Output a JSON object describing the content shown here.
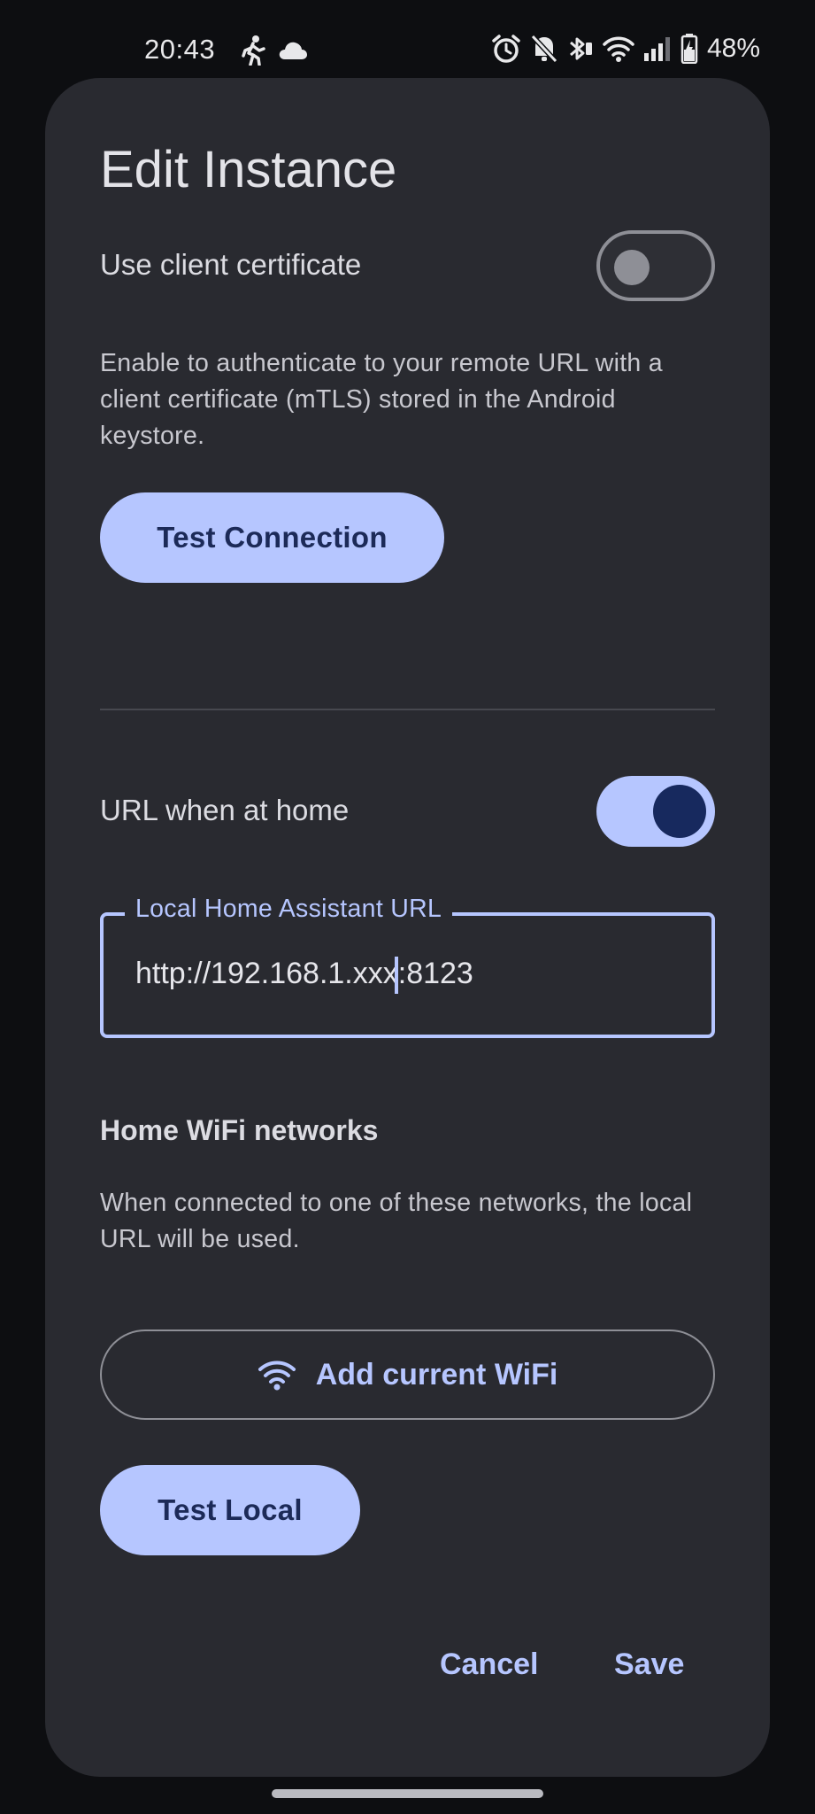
{
  "status_bar": {
    "time": "20:43",
    "battery": "48%",
    "icons": [
      "walking-icon",
      "cloud-icon",
      "alarm-icon",
      "notifications-off-icon",
      "bluetooth-icon",
      "wifi-icon",
      "signal-icon",
      "battery-charging-icon"
    ]
  },
  "dialog": {
    "title": "Edit Instance",
    "client_certificate": {
      "label": "Use client certificate",
      "enabled": false,
      "description": "Enable to authenticate to your remote URL with a client certificate (mTLS) stored in the Android keystore."
    },
    "test_connection_label": "Test Connection",
    "home_url": {
      "label": "URL when at home",
      "enabled": true
    },
    "local_url_field": {
      "label": "Local Home Assistant URL",
      "value": "http://192.168.1.xxx:8123"
    },
    "home_wifi": {
      "heading": "Home WiFi networks",
      "description": "When connected to one of these networks, the local URL will be used.",
      "add_wifi_label": "Add current WiFi"
    },
    "test_local_label": "Test Local",
    "cancel_label": "Cancel",
    "save_label": "Save"
  },
  "colors": {
    "accent": "#b6c6ff",
    "on_accent": "#1c2a58",
    "surface": "#292a30",
    "background": "#0d0e11"
  }
}
